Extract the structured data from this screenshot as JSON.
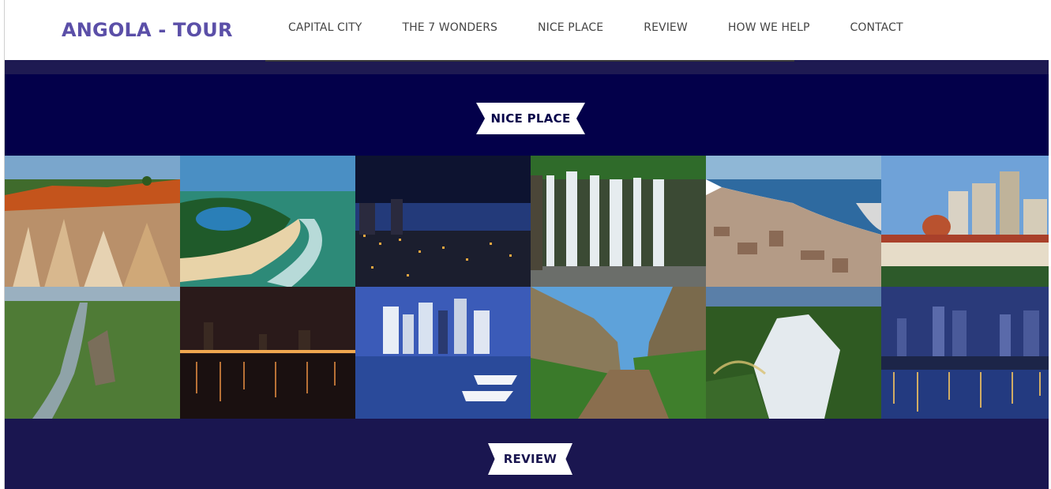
{
  "brand": {
    "title": "ANGOLA - TOUR"
  },
  "nav": {
    "items": [
      {
        "label": "CAPITAL CITY"
      },
      {
        "label": "THE 7 WONDERS"
      },
      {
        "label": "NICE PLACE"
      },
      {
        "label": "REVIEW"
      },
      {
        "label": "HOW WE HELP"
      },
      {
        "label": "CONTACT"
      }
    ]
  },
  "sections": {
    "nice_place": {
      "title": "NICE PLACE"
    },
    "review": {
      "title": "REVIEW"
    }
  },
  "colors": {
    "brand": "#5b4fa8",
    "nice_place_bg": "#03004a",
    "review_bg": "#1a1650",
    "nav_text": "#444444"
  }
}
